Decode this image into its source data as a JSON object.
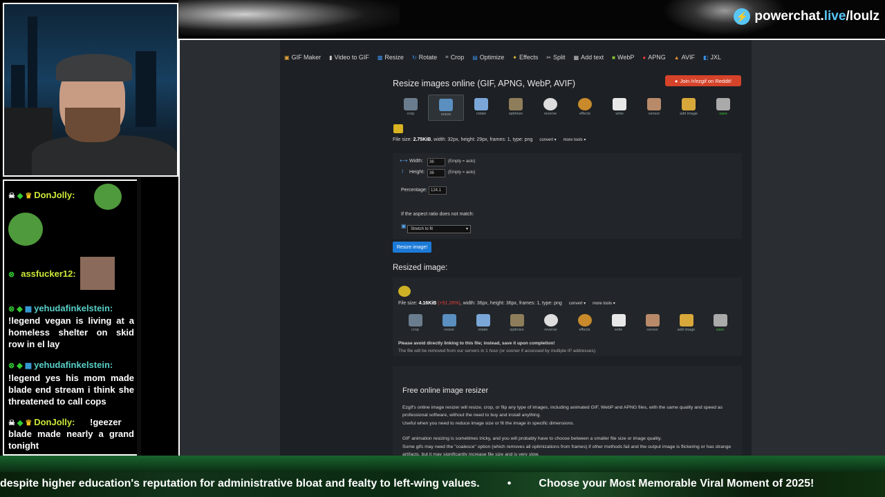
{
  "brand": {
    "prefix": "powerchat.",
    "live": "live",
    "suffix": "/loulz"
  },
  "chat": {
    "messages": [
      {
        "user": "DonJolly:",
        "text": ""
      },
      {
        "user": "assfucker12:",
        "text": ""
      },
      {
        "user": "yehudafinkelstein:",
        "text": "!legend vegan is living at a homeless shelter on skid row in el lay"
      },
      {
        "user": "yehudafinkelstein:",
        "text": "!legend yes his mom made blade end stream i think she threatened to call cops"
      },
      {
        "user": "DonJolly:",
        "text": "!geezer blade made nearly a grand tonight"
      }
    ]
  },
  "nav": [
    "GIF Maker",
    "Video to GIF",
    "Resize",
    "Rotate",
    "Crop",
    "Optimize",
    "Effects",
    "Split",
    "Add text",
    "WebP",
    "APNG",
    "AVIF",
    "JXL"
  ],
  "page": {
    "title": "Resize images online (GIF, APNG, WebP, AVIF)",
    "reddit_button": "Join /r/ezgif on Reddit!",
    "tools": [
      "crop",
      "resize",
      "rotate",
      "optimize",
      "reverse",
      "effects",
      "write",
      "censor",
      "add image",
      "save"
    ],
    "file1": {
      "label": "File size:",
      "size": "2.75KiB",
      "rest": ", width: 32px, height: 29px, frames: 1, type: png"
    },
    "convert": "convert",
    "more_tools": "more tools",
    "width_label": "Width:",
    "width_value": "36",
    "height_label": "Height:",
    "height_value": "36",
    "empty_hint": "(Empty = auto)",
    "percentage_label": "Percentage:",
    "percentage_value": "124.1",
    "aspect_label": "If the aspect ratio does not match:",
    "aspect_select": "Stretch to fit",
    "resize_button": "Resize image!",
    "resized_heading": "Resized image:",
    "file2": {
      "label": "File size:",
      "size": "4.16KiB",
      "delta": "(+51.26%)",
      "rest": ", width: 36px, height: 36px, frames: 1, type: png"
    },
    "note1": "Please avoid directly linking to this file; instead, save it upon completion!",
    "note2": "The file will be removed from our servers in 1 hour (or sooner if accessed by multiple IP addresses).",
    "info_heading": "Free online image resizer",
    "para1": "Ezgif's online image resizer will resize, crop, or flip any type of images, including animated GIF, WebP and APNG files, with the same quality and speed as professional software, without the need to buy and install anything.",
    "para2": "Useful when you need to reduce image size or fit the image in specific dimensions.",
    "para3": "GIF animation resizing is sometimes tricky, and you will probably have to choose between a smaller file size or image quality.",
    "para4": "Some gifs may need the \"coalesce\" option (which removes all optimizations from frames) if other methods fail and the output image is flickering or has strange artifacts, but it may significantly increase file size and is very slow."
  },
  "ticker": {
    "left": "despite higher education's reputation for administrative bloat and fealty to left-wing values.",
    "separator": "•",
    "right": "Choose your Most Memorable Viral Moment of 2025!"
  }
}
